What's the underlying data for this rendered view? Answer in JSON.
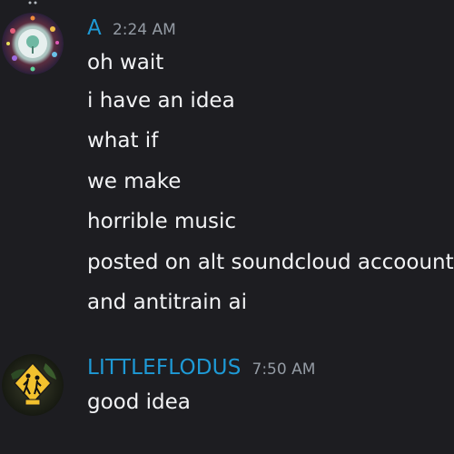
{
  "messages": [
    {
      "author": "A",
      "author_color": "#1e9ad6",
      "timestamp": "2:24 AM",
      "avatar_icon": "colorful-orb-avatar",
      "lines": [
        "oh wait",
        "i have an idea",
        "what if",
        "we make",
        "horrible music",
        "posted on alt soundcloud accoount",
        "and antitrain ai"
      ]
    },
    {
      "author": "LITTLEFLODUS",
      "author_color": "#1e9ad6",
      "timestamp": "7:50 AM",
      "avatar_icon": "school-crossing-sign-avatar",
      "lines": [
        "good idea"
      ]
    }
  ],
  "colors": {
    "background": "#1d1d21",
    "text": "#f2f3f5",
    "timestamp": "#949ba4"
  }
}
